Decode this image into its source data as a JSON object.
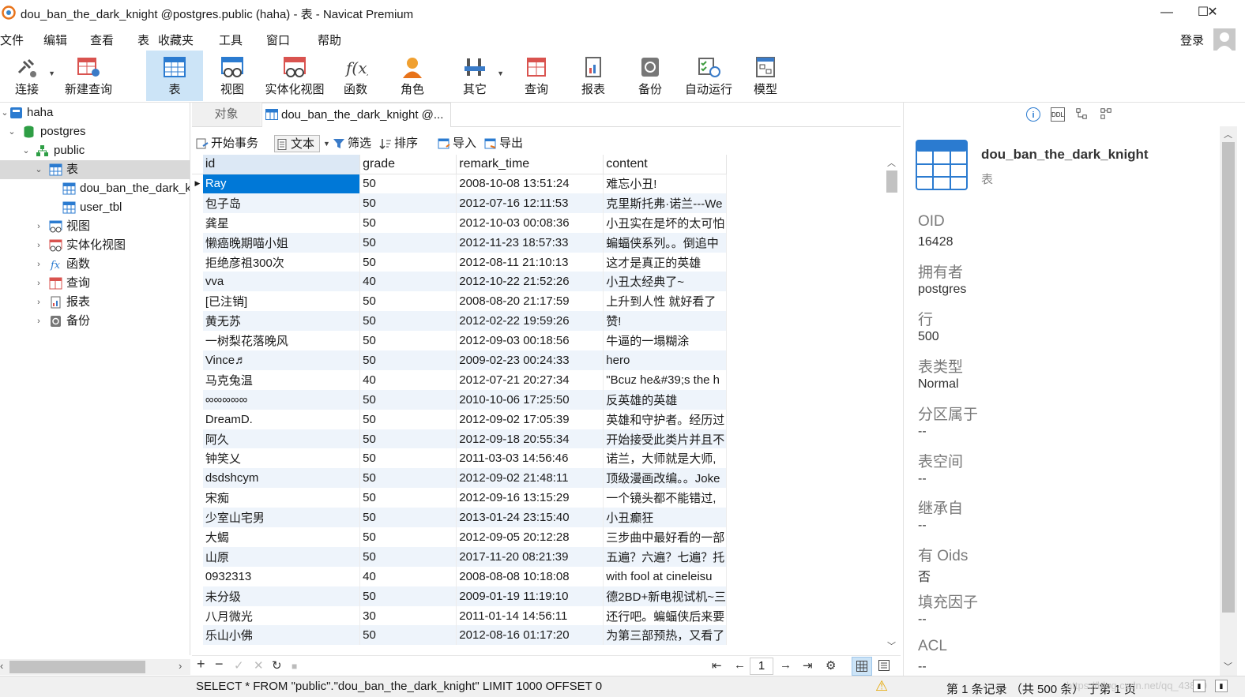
{
  "window": {
    "title": "dou_ban_the_dark_knight @postgres.public (haha) - 表 - Navicat Premium",
    "minimize": "—",
    "maximize": "☐",
    "close": "✕"
  },
  "menu": {
    "items": [
      "文件",
      "编辑",
      "查看",
      "表",
      "收藏夹",
      "工具",
      "窗口",
      "帮助"
    ],
    "login": "登录"
  },
  "toolbar": {
    "items": [
      "连接",
      "新建查询",
      "表",
      "视图",
      "实体化视图",
      "函数",
      "角色",
      "其它",
      "查询",
      "报表",
      "备份",
      "自动运行",
      "模型"
    ],
    "active": "表"
  },
  "sidebar": {
    "tree": [
      {
        "label": "haha",
        "icon": "server-icon",
        "twisty": "⌄"
      },
      {
        "label": "postgres",
        "icon": "database-icon",
        "twisty": "⌄"
      },
      {
        "label": "public",
        "icon": "schema-icon",
        "twisty": "⌄"
      },
      {
        "label": "表",
        "icon": "table-icon",
        "twisty": "⌄"
      },
      {
        "label": "dou_ban_the_dark_knight",
        "icon": "table-icon",
        "twisty": ""
      },
      {
        "label": "user_tbl",
        "icon": "table-icon",
        "twisty": ""
      },
      {
        "label": "视图",
        "icon": "view-icon",
        "twisty": "›"
      },
      {
        "label": "实体化视图",
        "icon": "materialized-view-icon",
        "twisty": "›"
      },
      {
        "label": "函数",
        "icon": "function-icon",
        "twisty": "›"
      },
      {
        "label": "查询",
        "icon": "query-icon",
        "twisty": "›"
      },
      {
        "label": "报表",
        "icon": "report-icon",
        "twisty": "›"
      },
      {
        "label": "备份",
        "icon": "backup-icon",
        "twisty": "›"
      }
    ]
  },
  "tabs": {
    "objects": "对象",
    "document": "dou_ban_the_dark_knight @..."
  },
  "subtoolbar": {
    "begin_tx": "开始事务",
    "text": "文本",
    "filter": "筛选",
    "sort": "排序",
    "import": "导入",
    "export": "导出"
  },
  "grid": {
    "columns": [
      "id",
      "grade",
      "remark_time",
      "content"
    ],
    "rows": [
      [
        "Ray",
        "50",
        "2008-10-08 13:51:24",
        "难忘小丑!"
      ],
      [
        "包子岛",
        "50",
        "2012-07-16 12:11:53",
        "克里斯托弗·诺兰---We"
      ],
      [
        "龚星",
        "50",
        "2012-10-03 00:08:36",
        "小丑实在是坏的太可怕"
      ],
      [
        "懒癌晚期喵小姐",
        "50",
        "2012-11-23 18:57:33",
        "蝙蝠侠系列。。倒追中"
      ],
      [
        "拒绝彦祖300次",
        "50",
        "2012-08-11 21:10:13",
        "这才是真正的英雄"
      ],
      [
        "vva",
        "40",
        "2012-10-22 21:52:26",
        "小丑太经典了~"
      ],
      [
        "[已注销]",
        "50",
        "2008-08-20 21:17:59",
        "上升到人性 就好看了"
      ],
      [
        "黄无苏",
        "50",
        "2012-02-22 19:59:26",
        "赞!"
      ],
      [
        "一树梨花落晚风",
        "50",
        "2012-09-03 00:18:56",
        "牛逼的一塌糊涂"
      ],
      [
        "Vince♬",
        "50",
        "2009-02-23 00:24:33",
        "hero"
      ],
      [
        "马克兔温",
        "40",
        "2012-07-21 20:27:34",
        "\"Bcuz he&#39;s the h"
      ],
      [
        "∞∞∞∞∞",
        "50",
        "2010-10-06 17:25:50",
        "反英雄的英雄"
      ],
      [
        "DreamD.",
        "50",
        "2012-09-02 17:05:39",
        "英雄和守护者。经历过"
      ],
      [
        "阿久",
        "50",
        "2012-09-18 20:55:34",
        "开始接受此类片并且不"
      ],
      [
        "钟笑乂",
        "50",
        "2011-03-03 14:56:46",
        "诺兰，大师就是大师,"
      ],
      [
        "dsdshcym",
        "50",
        "2012-09-02 21:48:11",
        "顶级漫画改编。。Joke"
      ],
      [
        "宋痴",
        "50",
        "2012-09-16 13:15:29",
        "一个镜头都不能错过,"
      ],
      [
        "少室山宅男",
        "50",
        "2013-01-24 23:15:40",
        "小丑癫狂"
      ],
      [
        "大蝎",
        "50",
        "2012-09-05 20:12:28",
        "三步曲中最好看的一部"
      ],
      [
        "山原",
        "50",
        "2017-11-20 08:21:39",
        "五遍？六遍？七遍？托"
      ],
      [
        "0932313",
        "40",
        "2008-08-08 10:18:08",
        "with fool at cineleisu"
      ],
      [
        "未分级",
        "50",
        "2009-01-19 11:19:10",
        "德2BD+新电视试机~三"
      ],
      [
        "八月微光",
        "30",
        "2011-01-14 14:56:11",
        "还行吧。蝙蝠侠后来要"
      ],
      [
        "乐山小佛",
        "50",
        "2012-08-16 01:17:20",
        "为第三部预热，又看了"
      ]
    ]
  },
  "bottombar": {
    "add": "+",
    "remove": "−",
    "apply": "✓",
    "discard": "✕",
    "refresh": "↻",
    "stop": "■",
    "first": "⇤",
    "prev": "←",
    "page": "1",
    "next": "→",
    "last": "⇥",
    "settings": "⚙"
  },
  "statusbar": {
    "sql": "SELECT * FROM \"public\".\"dou_ban_the_dark_knight\" LIMIT 1000 OFFSET 0",
    "records": "第 1 条记录 （共 500 条） 于第 1 页",
    "watermark": "https://blog.csdn.net/qq_43840"
  },
  "info": {
    "table_name": "dou_ban_the_dark_knight",
    "table_type_label": "表",
    "props": [
      {
        "k": "OID",
        "v": "16428"
      },
      {
        "k": "拥有者",
        "v": "postgres"
      },
      {
        "k": "行",
        "v": "500"
      },
      {
        "k": "表类型",
        "v": "Normal"
      },
      {
        "k": "分区属于",
        "v": "--"
      },
      {
        "k": "表空间",
        "v": "--"
      },
      {
        "k": "继承自",
        "v": "--"
      },
      {
        "k": "有 Oids",
        "v": "否"
      },
      {
        "k": "填充因子",
        "v": "--"
      },
      {
        "k": "ACL",
        "v": "--"
      }
    ]
  },
  "colors": {
    "accent": "#0078d7",
    "toolbar_active": "#cce4f7",
    "row_alt": "#eef4fb",
    "tree_selected": "#d9d9d9"
  }
}
